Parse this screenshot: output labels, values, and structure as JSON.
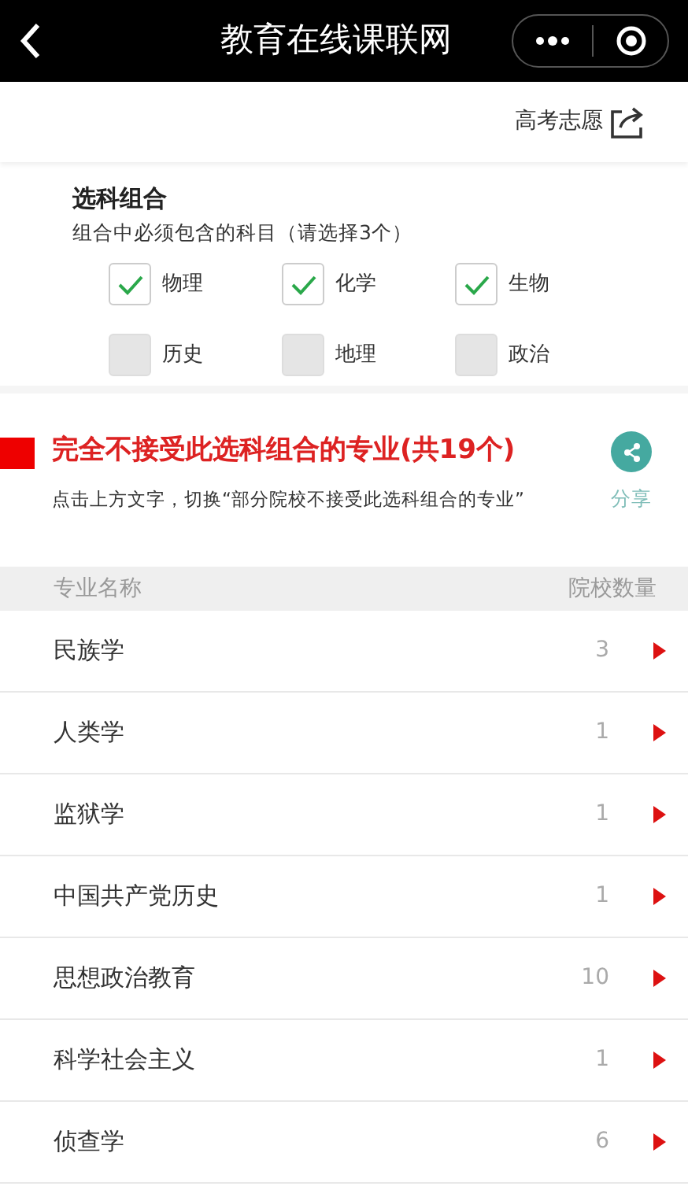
{
  "title": "教育在线课联网",
  "top_link": "高考志愿",
  "selection": {
    "title": "选科组合",
    "hint": "组合中必须包含的科目（请选择3个）",
    "subjects": [
      {
        "label": "物理",
        "checked": true
      },
      {
        "label": "化学",
        "checked": true
      },
      {
        "label": "生物",
        "checked": true
      },
      {
        "label": "历史",
        "checked": false
      },
      {
        "label": "地理",
        "checked": false
      },
      {
        "label": "政治",
        "checked": false
      }
    ]
  },
  "banner": {
    "heading": "完全不接受此选科组合的专业(共19个)",
    "subtext": "点击上方文字，切换“部分院校不接受此选科组合的专业”",
    "share_label": "分享"
  },
  "table": {
    "columns": [
      "专业名称",
      "院校数量"
    ],
    "rows": [
      {
        "name": "民族学",
        "count": "3"
      },
      {
        "name": "人类学",
        "count": "1"
      },
      {
        "name": "监狱学",
        "count": "1"
      },
      {
        "name": "中国共产党历史",
        "count": "1"
      },
      {
        "name": "思想政治教育",
        "count": "10"
      },
      {
        "name": "科学社会主义",
        "count": "1"
      },
      {
        "name": "侦查学",
        "count": "6"
      }
    ]
  }
}
